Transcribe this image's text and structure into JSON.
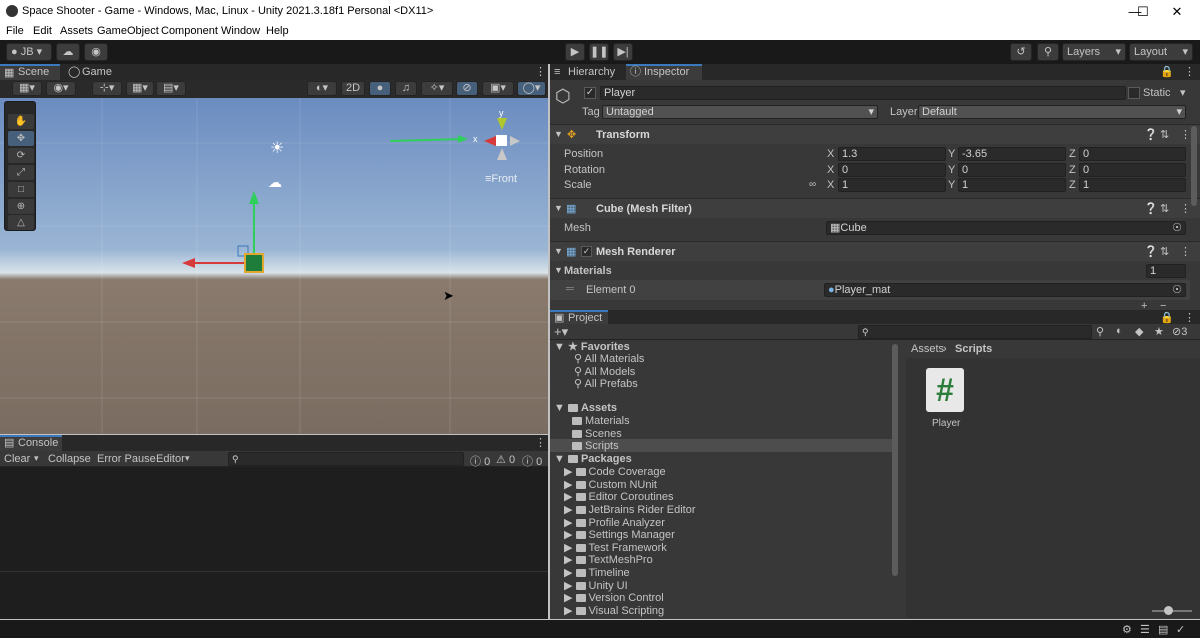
{
  "window": {
    "title": "Space Shooter - Game - Windows, Mac, Linux - Unity 2021.3.18f1 Personal <DX11>"
  },
  "menu": [
    "File",
    "Edit",
    "Assets",
    "GameObject",
    "Component",
    "Window",
    "Help"
  ],
  "toolbar": {
    "account": "JB",
    "layers": "Layers",
    "layout": "Layout"
  },
  "scene_tabs": {
    "scene": "Scene",
    "game": "Game"
  },
  "scene": {
    "mode_2d": "2D",
    "front_label": "Front",
    "axis_x": "x",
    "axis_y": "y"
  },
  "console": {
    "tab": "Console",
    "clear": "Clear",
    "collapse": "Collapse",
    "error_pause": "Error Pause",
    "editor": "Editor",
    "count_info": "0",
    "count_warn": "0",
    "count_err": "0"
  },
  "inspector_tabs": {
    "hierarchy": "Hierarchy",
    "inspector": "Inspector"
  },
  "inspector": {
    "object_name": "Player",
    "static_label": "Static",
    "tag_label": "Tag",
    "tag_value": "Untagged",
    "layer_label": "Layer",
    "layer_value": "Default",
    "transform": {
      "title": "Transform",
      "position_label": "Position",
      "rotation_label": "Rotation",
      "scale_label": "Scale",
      "pos": {
        "x": "1.3",
        "y": "-3.65",
        "z": "0"
      },
      "rot": {
        "x": "0",
        "y": "0",
        "z": "0"
      },
      "scale": {
        "x": "1",
        "y": "1",
        "z": "1"
      },
      "axis_x": "X",
      "axis_y": "Y",
      "axis_z": "Z"
    },
    "mesh_filter": {
      "title": "Cube (Mesh Filter)",
      "mesh_label": "Mesh",
      "mesh_value": "Cube"
    },
    "mesh_renderer": {
      "title": "Mesh Renderer",
      "materials_label": "Materials",
      "materials_count": "1",
      "element0_label": "Element 0",
      "element0_value": "Player_mat"
    }
  },
  "project": {
    "tab": "Project",
    "hidden_count": "3",
    "breadcrumb": {
      "root": "Assets",
      "current": "Scripts"
    },
    "favorites": {
      "label": "Favorites",
      "items": [
        "All Materials",
        "All Models",
        "All Prefabs"
      ]
    },
    "assets": {
      "label": "Assets",
      "items": [
        "Materials",
        "Scenes",
        "Scripts"
      ]
    },
    "packages": {
      "label": "Packages",
      "items": [
        "Code Coverage",
        "Custom NUnit",
        "Editor Coroutines",
        "JetBrains Rider Editor",
        "Profile Analyzer",
        "Settings Manager",
        "Test Framework",
        "TextMeshPro",
        "Timeline",
        "Unity UI",
        "Version Control",
        "Visual Scripting"
      ]
    },
    "file": {
      "name": "Player",
      "glyph": "#"
    }
  },
  "colors": {
    "accent": "#3a79bb",
    "green_gizmo": "#2fd05a",
    "red_gizmo": "#d63a3a"
  }
}
